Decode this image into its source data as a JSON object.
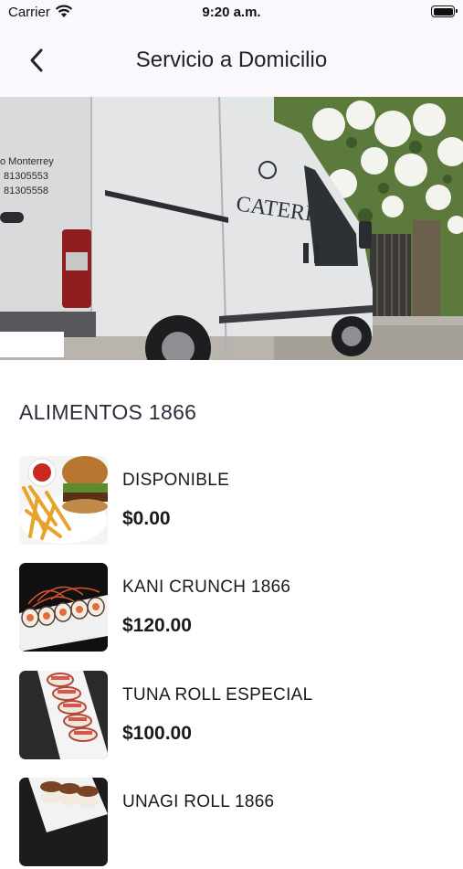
{
  "status_bar": {
    "carrier": "Carrier",
    "time": "9:20 a.m."
  },
  "nav": {
    "title": "Servicio a Domicilio"
  },
  "hero": {
    "van_text": [
      "o Monterrey",
      "81305553",
      "81305558"
    ],
    "brand": "CATERING"
  },
  "section": {
    "title": "ALIMENTOS 1866"
  },
  "items": [
    {
      "name": "DISPONIBLE",
      "price": "$0.00",
      "image": "burger-fries"
    },
    {
      "name": "KANI CRUNCH 1866",
      "price": "$120.00",
      "image": "sushi-roll-dark"
    },
    {
      "name": "TUNA ROLL ESPECIAL",
      "price": "$100.00",
      "image": "sushi-roll-white-plate"
    },
    {
      "name": "UNAGI ROLL 1866",
      "price": "",
      "image": "sushi-roll-unagi"
    }
  ]
}
